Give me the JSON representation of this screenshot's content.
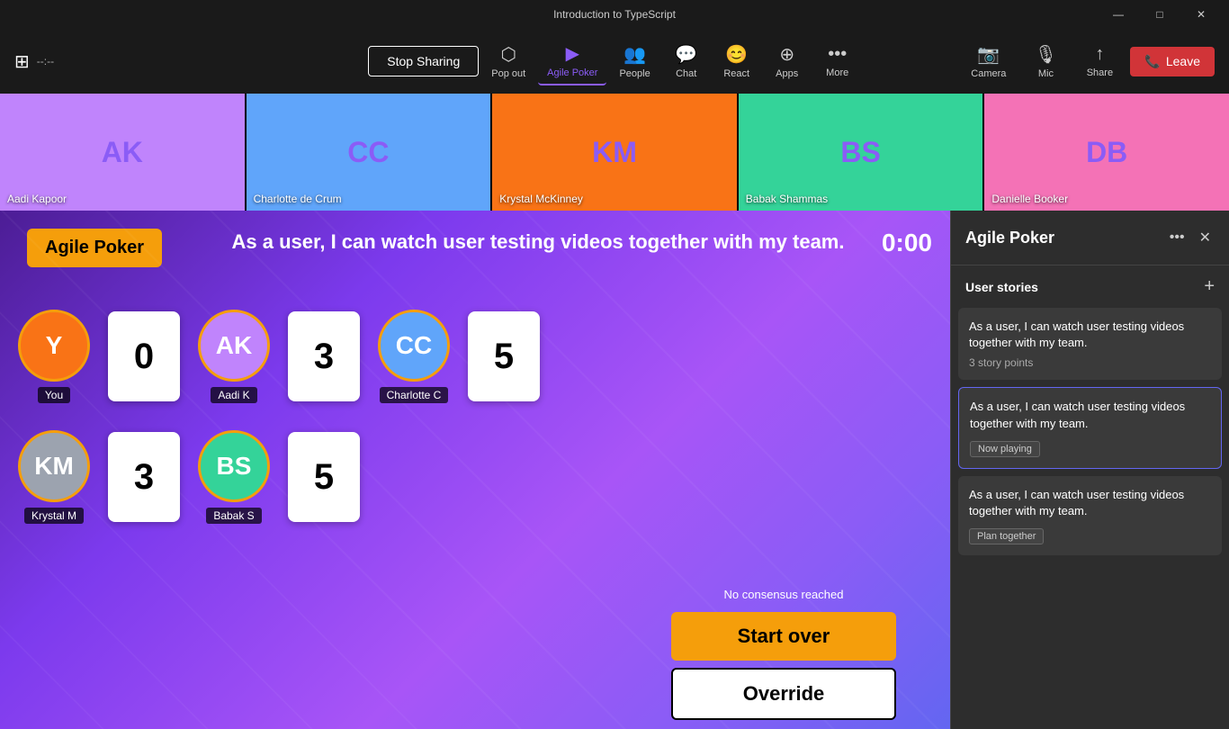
{
  "titlebar": {
    "title": "Introduction to TypeScript",
    "minimize": "—",
    "maximize": "□",
    "close": "✕"
  },
  "toolbar": {
    "stop_sharing": "Stop Sharing",
    "pop_out": "Pop out",
    "agile_poker": "Agile Poker",
    "people": "People",
    "chat": "Chat",
    "react": "React",
    "apps": "Apps",
    "more": "More",
    "camera": "Camera",
    "mic": "Mic",
    "share": "Share",
    "leave": "Leave"
  },
  "video_strip": [
    {
      "name": "Aadi Kapoor",
      "initials": "AK"
    },
    {
      "name": "Charlotte de Crum",
      "initials": "CC"
    },
    {
      "name": "Krystal McKinney",
      "initials": "KM"
    },
    {
      "name": "Babak Shammas",
      "initials": "BS"
    },
    {
      "name": "Danielle Booker",
      "initials": "DB"
    }
  ],
  "game": {
    "title": "Agile Poker",
    "story": "As a user, I can watch user testing videos together with my team.",
    "timer": "0:00",
    "players": [
      {
        "name": "You",
        "vote": "0",
        "initials": "Y"
      },
      {
        "name": "Aadi K",
        "vote": "3",
        "initials": "AK"
      },
      {
        "name": "Charlotte C",
        "vote": "5",
        "initials": "CC"
      },
      {
        "name": "Krystal M",
        "vote": "3",
        "initials": "KM"
      },
      {
        "name": "Babak S",
        "vote": "5",
        "initials": "BS"
      }
    ],
    "no_consensus": "No consensus reached",
    "start_over": "Start over",
    "override": "Override"
  },
  "side_panel": {
    "title": "Agile Poker",
    "user_stories_label": "User stories",
    "stories": [
      {
        "text": "As a user, I can watch user testing videos together with my team.",
        "meta": "3 story points",
        "badge": null
      },
      {
        "text": "As a user, I can watch user testing videos together with my team.",
        "meta": null,
        "badge": "Now playing"
      },
      {
        "text": "As a user, I can watch user testing videos together with my team.",
        "meta": null,
        "badge": "Plan together"
      }
    ]
  }
}
